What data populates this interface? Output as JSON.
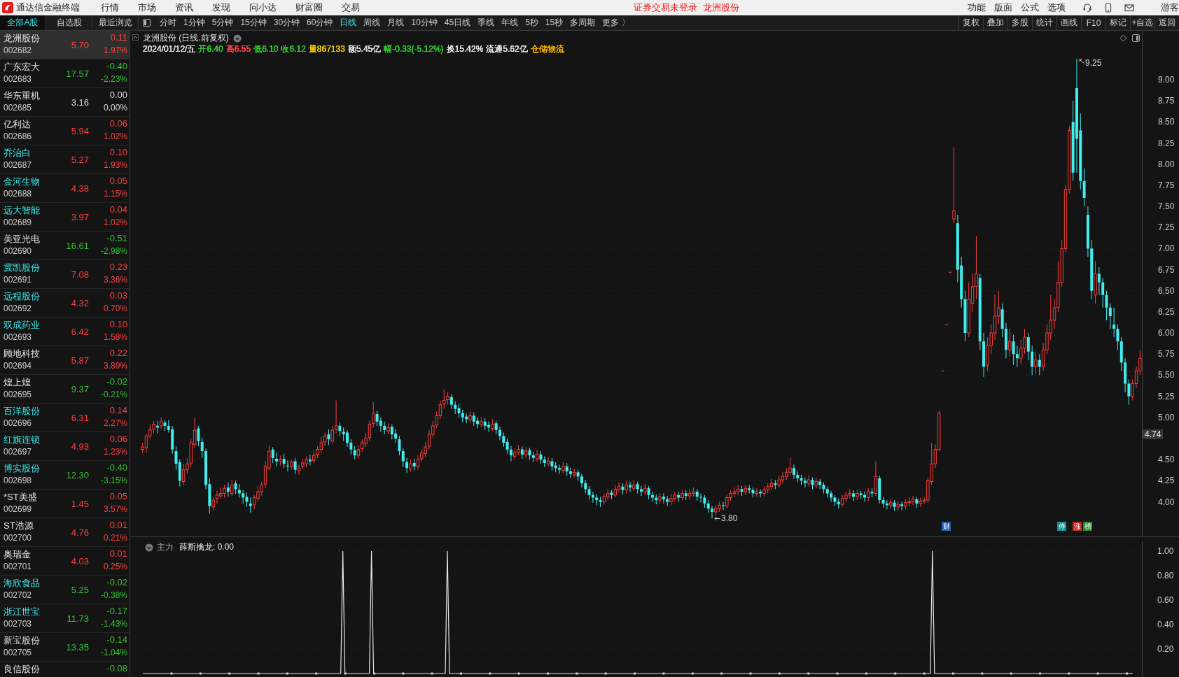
{
  "title_bar": {
    "app_name": "通达信金融终端",
    "menu": [
      "行情",
      "市场",
      "资讯",
      "发现",
      "问小达",
      "财富圈",
      "交易"
    ],
    "login_notice": "证券交易未登录",
    "current_stock": "龙洲股份",
    "tools": [
      "功能",
      "版面",
      "公式",
      "选项"
    ],
    "user": "游客"
  },
  "toolbar": {
    "list_tabs": [
      {
        "label": "全部A股",
        "selected": true
      },
      {
        "label": "自选股",
        "selected": false
      },
      {
        "label": "最近浏览",
        "selected": false
      }
    ],
    "periods": [
      {
        "label": "分时",
        "selected": false
      },
      {
        "label": "1分钟",
        "selected": false
      },
      {
        "label": "5分钟",
        "selected": false
      },
      {
        "label": "15分钟",
        "selected": false
      },
      {
        "label": "30分钟",
        "selected": false
      },
      {
        "label": "60分钟",
        "selected": false
      },
      {
        "label": "日线",
        "selected": true
      },
      {
        "label": "周线",
        "selected": false
      },
      {
        "label": "月线",
        "selected": false
      },
      {
        "label": "10分钟",
        "selected": false
      },
      {
        "label": "45日线",
        "selected": false
      },
      {
        "label": "季线",
        "selected": false
      },
      {
        "label": "年线",
        "selected": false
      },
      {
        "label": "5秒",
        "selected": false
      },
      {
        "label": "15秒",
        "selected": false
      },
      {
        "label": "多周期",
        "selected": false
      }
    ],
    "more_button": "更多 〉",
    "actions": [
      "复权",
      "叠加",
      "多股",
      "统计",
      "画线",
      "F10",
      "标记",
      "+自选",
      "返回"
    ]
  },
  "stock_list": [
    {
      "name": "龙洲股份",
      "code": "002682",
      "price": "5.70",
      "change": "0.11",
      "percent": "1.97%",
      "color": "#ff4040",
      "highlighted": false,
      "selected": true
    },
    {
      "name": "广东宏大",
      "code": "002683",
      "price": "17.57",
      "change": "-0.40",
      "percent": "-2.23%",
      "color": "#34c234",
      "highlighted": false,
      "selected": false
    },
    {
      "name": "华东重机",
      "code": "002685",
      "price": "3.16",
      "change": "0.00",
      "percent": "0.00%",
      "color": "#d8d8d8",
      "highlighted": false,
      "selected": false
    },
    {
      "name": "亿利达",
      "code": "002686",
      "price": "5.94",
      "change": "0.06",
      "percent": "1.02%",
      "color": "#ff4040",
      "highlighted": false,
      "selected": false
    },
    {
      "name": "乔治白",
      "code": "002687",
      "price": "5.27",
      "change": "0.10",
      "percent": "1.93%",
      "color": "#ff4040",
      "highlighted": true,
      "selected": false
    },
    {
      "name": "金河生物",
      "code": "002688",
      "price": "4.38",
      "change": "0.05",
      "percent": "1.15%",
      "color": "#ff4040",
      "highlighted": true,
      "selected": false
    },
    {
      "name": "远大智能",
      "code": "002689",
      "price": "3.97",
      "change": "0.04",
      "percent": "1.02%",
      "color": "#ff4040",
      "highlighted": true,
      "selected": false
    },
    {
      "name": "美亚光电",
      "code": "002690",
      "price": "16.61",
      "change": "-0.51",
      "percent": "-2.98%",
      "color": "#34c234",
      "highlighted": false,
      "selected": false
    },
    {
      "name": "冀凯股份",
      "code": "002691",
      "price": "7.08",
      "change": "0.23",
      "percent": "3.36%",
      "color": "#ff4040",
      "highlighted": true,
      "selected": false
    },
    {
      "name": "远程股份",
      "code": "002692",
      "price": "4.32",
      "change": "0.03",
      "percent": "0.70%",
      "color": "#ff4040",
      "highlighted": true,
      "selected": false
    },
    {
      "name": "双成药业",
      "code": "002693",
      "price": "6.42",
      "change": "0.10",
      "percent": "1.58%",
      "color": "#ff4040",
      "highlighted": true,
      "selected": false
    },
    {
      "name": "顾地科技",
      "code": "002694",
      "price": "5.87",
      "change": "0.22",
      "percent": "3.89%",
      "color": "#ff4040",
      "highlighted": false,
      "selected": false
    },
    {
      "name": "煌上煌",
      "code": "002695",
      "price": "9.37",
      "change": "-0.02",
      "percent": "-0.21%",
      "color": "#34c234",
      "highlighted": false,
      "selected": false
    },
    {
      "name": "百洋股份",
      "code": "002696",
      "price": "6.31",
      "change": "0.14",
      "percent": "2.27%",
      "color": "#ff4040",
      "highlighted": true,
      "selected": false
    },
    {
      "name": "红旗连锁",
      "code": "002697",
      "price": "4.93",
      "change": "0.06",
      "percent": "1.23%",
      "color": "#ff4040",
      "highlighted": true,
      "selected": false
    },
    {
      "name": "博实股份",
      "code": "002698",
      "price": "12.30",
      "change": "-0.40",
      "percent": "-3.15%",
      "color": "#34c234",
      "highlighted": true,
      "selected": false
    },
    {
      "name": "*ST美盛",
      "code": "002699",
      "price": "1.45",
      "change": "0.05",
      "percent": "3.57%",
      "color": "#ff4040",
      "highlighted": false,
      "selected": false
    },
    {
      "name": "ST浩源",
      "code": "002700",
      "price": "4.76",
      "change": "0.01",
      "percent": "0.21%",
      "color": "#ff4040",
      "highlighted": false,
      "selected": false
    },
    {
      "name": "奥瑞金",
      "code": "002701",
      "price": "4.03",
      "change": "0.01",
      "percent": "0.25%",
      "color": "#ff4040",
      "highlighted": false,
      "selected": false
    },
    {
      "name": "海欣食品",
      "code": "002702",
      "price": "5.25",
      "change": "-0.02",
      "percent": "-0.38%",
      "color": "#34c234",
      "highlighted": true,
      "selected": false
    },
    {
      "name": "浙江世宝",
      "code": "002703",
      "price": "11.73",
      "change": "-0.17",
      "percent": "-1.43%",
      "color": "#34c234",
      "highlighted": true,
      "selected": false
    },
    {
      "name": "新宝股份",
      "code": "002705",
      "price": "13.35",
      "change": "-0.14",
      "percent": "-1.04%",
      "color": "#34c234",
      "highlighted": false,
      "selected": false
    },
    {
      "name": "良信股份",
      "change": "-0.08",
      "color": "#34c234",
      "highlighted": false,
      "selected": false
    }
  ],
  "chart": {
    "title": "龙洲股份 (日线.前复权)",
    "info": [
      {
        "text": "2024/01/12/五",
        "color": "#e0e0e0"
      },
      {
        "text": "开6.40",
        "color": "#34c234"
      },
      {
        "text": "高6.55",
        "color": "#ff4040"
      },
      {
        "text": "低6.10",
        "color": "#34c234"
      },
      {
        "text": "收6.12",
        "color": "#34c234"
      },
      {
        "text": "量867133",
        "color": "#e8c200"
      },
      {
        "text": "额5.45亿",
        "color": "#e0e0e0"
      },
      {
        "text": "幅-0.33(-5.12%)",
        "color": "#34c234"
      },
      {
        "text": "换15.42%",
        "color": "#e0e0e0"
      },
      {
        "text": "流通5.62亿",
        "color": "#e0e0e0"
      },
      {
        "text": "仓储物流",
        "color": "#e8a800"
      }
    ],
    "current_price": "4.74",
    "chart_data": {
      "type": "candlestick",
      "grid": true,
      "ylim": [
        3.59,
        9.58
      ],
      "yticks": [
        {
          "value": 9,
          "label": "9.00"
        },
        {
          "value": 8.75,
          "label": "8.75"
        },
        {
          "value": 8.5,
          "label": "8.50"
        },
        {
          "value": 8.25,
          "label": "8.25"
        },
        {
          "value": 8,
          "label": "8.00"
        },
        {
          "value": 7.75,
          "label": "7.75"
        },
        {
          "value": 7.5,
          "label": "7.50"
        },
        {
          "value": 7.25,
          "label": "7.25"
        },
        {
          "value": 7,
          "label": "7.00"
        },
        {
          "value": 6.75,
          "label": "6.75"
        },
        {
          "value": 6.5,
          "label": "6.50"
        },
        {
          "value": 6.25,
          "label": "6.25"
        },
        {
          "value": 6,
          "label": "6.00"
        },
        {
          "value": 5.75,
          "label": "5.75"
        },
        {
          "value": 5.5,
          "label": "5.50"
        },
        {
          "value": 5.25,
          "label": "5.25"
        },
        {
          "value": 5,
          "label": "5.00"
        },
        {
          "value": 4.5,
          "label": "4.50"
        },
        {
          "value": 4.25,
          "label": "4.25"
        },
        {
          "value": 4,
          "label": "4.00"
        }
      ],
      "annotations": [
        "9.25",
        "3.80"
      ],
      "ohlc": [
        [
          4.62,
          4.7,
          4.58,
          4.65
        ],
        [
          4.64,
          4.81,
          4.58,
          4.78
        ],
        [
          4.78,
          4.92,
          4.75,
          4.85
        ],
        [
          4.86,
          4.96,
          4.81,
          4.92
        ],
        [
          4.9,
          4.96,
          4.81,
          4.88
        ],
        [
          4.9,
          5.0,
          4.86,
          4.95
        ],
        [
          4.94,
          4.97,
          4.84,
          4.9
        ],
        [
          4.9,
          4.97,
          4.82,
          4.85
        ],
        [
          4.86,
          4.9,
          4.57,
          4.62
        ],
        [
          4.6,
          4.66,
          4.38,
          4.45
        ],
        [
          4.47,
          4.5,
          4.18,
          4.25
        ],
        [
          4.24,
          4.45,
          4.2,
          4.38
        ],
        [
          4.38,
          4.52,
          4.33,
          4.45
        ],
        [
          4.46,
          4.74,
          4.41,
          4.7
        ],
        [
          4.68,
          4.99,
          4.64,
          4.85
        ],
        [
          4.87,
          4.9,
          4.66,
          4.72
        ],
        [
          4.71,
          4.76,
          4.52,
          4.6
        ],
        [
          4.6,
          4.63,
          4.15,
          4.2
        ],
        [
          4.21,
          4.28,
          3.86,
          3.95
        ],
        [
          3.94,
          4.06,
          3.89,
          4.02
        ],
        [
          4.04,
          4.13,
          3.98,
          4.08
        ],
        [
          4.07,
          4.17,
          4.04,
          4.1
        ],
        [
          4.1,
          4.2,
          4.05,
          4.16
        ],
        [
          4.17,
          4.23,
          4.06,
          4.12
        ],
        [
          4.1,
          4.26,
          4.07,
          4.2
        ],
        [
          4.22,
          4.25,
          4.09,
          4.15
        ],
        [
          4.14,
          4.21,
          4.05,
          4.1
        ],
        [
          4.1,
          4.14,
          3.98,
          4.05
        ],
        [
          4.06,
          4.11,
          3.94,
          4.0
        ],
        [
          3.98,
          4.05,
          3.87,
          3.95
        ],
        [
          3.97,
          4.08,
          3.91,
          4.05
        ],
        [
          4.04,
          4.19,
          4.01,
          4.12
        ],
        [
          4.12,
          4.24,
          4.07,
          4.2
        ],
        [
          4.21,
          4.48,
          4.16,
          4.42
        ],
        [
          4.4,
          4.67,
          4.37,
          4.6
        ],
        [
          4.62,
          4.65,
          4.46,
          4.52
        ],
        [
          4.51,
          4.58,
          4.42,
          4.48
        ],
        [
          4.48,
          4.55,
          4.43,
          4.5
        ],
        [
          4.51,
          4.57,
          4.4,
          4.45
        ],
        [
          4.43,
          4.49,
          4.36,
          4.42
        ],
        [
          4.42,
          4.5,
          4.38,
          4.47
        ],
        [
          4.48,
          4.52,
          4.33,
          4.38
        ],
        [
          4.37,
          4.44,
          4.32,
          4.4
        ],
        [
          4.42,
          4.51,
          4.39,
          4.46
        ],
        [
          4.45,
          4.54,
          4.41,
          4.5
        ],
        [
          4.5,
          4.56,
          4.43,
          4.48
        ],
        [
          4.49,
          4.61,
          4.46,
          4.55
        ],
        [
          4.56,
          4.66,
          4.52,
          4.62
        ],
        [
          4.62,
          4.77,
          4.59,
          4.7
        ],
        [
          4.71,
          4.82,
          4.66,
          4.78
        ],
        [
          4.8,
          4.86,
          4.67,
          4.74
        ],
        [
          4.72,
          4.9,
          4.69,
          4.85
        ],
        [
          4.86,
          5.2,
          4.81,
          4.9
        ],
        [
          4.9,
          4.94,
          4.78,
          4.84
        ],
        [
          4.83,
          4.88,
          4.72,
          4.8
        ],
        [
          4.82,
          4.85,
          4.65,
          4.7
        ],
        [
          4.7,
          4.74,
          4.56,
          4.62
        ],
        [
          4.61,
          4.66,
          4.5,
          4.55
        ],
        [
          4.55,
          4.67,
          4.51,
          4.62
        ],
        [
          4.63,
          4.74,
          4.59,
          4.7
        ],
        [
          4.69,
          4.82,
          4.65,
          4.75
        ],
        [
          4.76,
          4.97,
          4.72,
          4.92
        ],
        [
          4.93,
          5.18,
          4.88,
          5.05
        ],
        [
          5.04,
          5.08,
          4.9,
          4.95
        ],
        [
          4.96,
          5.0,
          4.83,
          4.9
        ],
        [
          4.9,
          4.95,
          4.8,
          4.85
        ],
        [
          4.84,
          4.93,
          4.8,
          4.88
        ],
        [
          4.89,
          4.92,
          4.74,
          4.8
        ],
        [
          4.81,
          4.86,
          4.7,
          4.75
        ],
        [
          4.74,
          4.78,
          4.55,
          4.6
        ],
        [
          4.6,
          4.63,
          4.41,
          4.48
        ],
        [
          4.47,
          4.52,
          4.34,
          4.4
        ],
        [
          4.39,
          4.5,
          4.35,
          4.45
        ],
        [
          4.46,
          4.51,
          4.37,
          4.42
        ],
        [
          4.42,
          4.55,
          4.38,
          4.5
        ],
        [
          4.51,
          4.62,
          4.47,
          4.58
        ],
        [
          4.57,
          4.71,
          4.53,
          4.65
        ],
        [
          4.66,
          4.85,
          4.62,
          4.8
        ],
        [
          4.8,
          4.96,
          4.76,
          4.9
        ],
        [
          4.91,
          5.07,
          4.87,
          5.02
        ],
        [
          5.02,
          5.2,
          4.98,
          5.15
        ],
        [
          5.16,
          5.33,
          5.1,
          5.2
        ],
        [
          5.21,
          5.3,
          5.15,
          5.25
        ],
        [
          5.24,
          5.28,
          5.1,
          5.15
        ],
        [
          5.15,
          5.19,
          5.04,
          5.1
        ],
        [
          5.11,
          5.16,
          5.0,
          5.05
        ],
        [
          5.05,
          5.09,
          4.94,
          5.0
        ],
        [
          5.01,
          5.05,
          4.93,
          4.98
        ],
        [
          4.97,
          5.07,
          4.93,
          5.02
        ],
        [
          5.02,
          5.06,
          4.9,
          4.95
        ],
        [
          4.96,
          5.0,
          4.87,
          4.92
        ],
        [
          4.92,
          5.0,
          4.88,
          4.95
        ],
        [
          4.95,
          4.99,
          4.85,
          4.9
        ],
        [
          4.91,
          4.95,
          4.83,
          4.88
        ],
        [
          4.87,
          4.98,
          4.84,
          4.92
        ],
        [
          4.93,
          4.96,
          4.8,
          4.85
        ],
        [
          4.85,
          4.89,
          4.73,
          4.78
        ],
        [
          4.78,
          4.82,
          4.65,
          4.7
        ],
        [
          4.71,
          4.75,
          4.57,
          4.62
        ],
        [
          4.62,
          4.66,
          4.48,
          4.55
        ],
        [
          4.54,
          4.63,
          4.5,
          4.58
        ],
        [
          4.59,
          4.67,
          4.55,
          4.62
        ],
        [
          4.62,
          4.66,
          4.51,
          4.56
        ],
        [
          4.56,
          4.65,
          4.52,
          4.6
        ],
        [
          4.61,
          4.64,
          4.5,
          4.55
        ],
        [
          4.55,
          4.59,
          4.47,
          4.52
        ],
        [
          4.51,
          4.61,
          4.48,
          4.56
        ],
        [
          4.56,
          4.6,
          4.45,
          4.5
        ],
        [
          4.5,
          4.54,
          4.41,
          4.46
        ],
        [
          4.45,
          4.53,
          4.42,
          4.48
        ],
        [
          4.48,
          4.52,
          4.37,
          4.42
        ],
        [
          4.43,
          4.47,
          4.35,
          4.4
        ],
        [
          4.4,
          4.44,
          4.33,
          4.38
        ],
        [
          4.37,
          4.47,
          4.34,
          4.42
        ],
        [
          4.42,
          4.46,
          4.31,
          4.36
        ],
        [
          4.36,
          4.4,
          4.28,
          4.33
        ],
        [
          4.32,
          4.39,
          4.29,
          4.35
        ],
        [
          4.35,
          4.38,
          4.25,
          4.3
        ],
        [
          4.3,
          4.33,
          4.17,
          4.22
        ],
        [
          4.22,
          4.26,
          4.1,
          4.15
        ],
        [
          4.15,
          4.19,
          4.03,
          4.08
        ],
        [
          4.08,
          4.12,
          3.99,
          4.05
        ],
        [
          4.05,
          4.09,
          3.96,
          4.02
        ],
        [
          4.02,
          4.06,
          3.94,
          4.0
        ],
        [
          4.0,
          4.1,
          3.97,
          4.06
        ],
        [
          4.06,
          4.15,
          4.02,
          4.1
        ],
        [
          4.11,
          4.14,
          4.03,
          4.08
        ],
        [
          4.08,
          4.2,
          4.05,
          4.15
        ],
        [
          4.15,
          4.23,
          4.11,
          4.18
        ],
        [
          4.18,
          4.22,
          4.09,
          4.14
        ],
        [
          4.14,
          4.25,
          4.1,
          4.2
        ],
        [
          4.2,
          4.24,
          4.12,
          4.17
        ],
        [
          4.16,
          4.26,
          4.13,
          4.2
        ],
        [
          4.21,
          4.24,
          4.1,
          4.15
        ],
        [
          4.15,
          4.19,
          4.07,
          4.12
        ],
        [
          4.12,
          4.21,
          4.08,
          4.16
        ],
        [
          4.16,
          4.19,
          4.03,
          4.08
        ],
        [
          4.08,
          4.12,
          4.0,
          4.05
        ],
        [
          4.05,
          4.09,
          3.97,
          4.02
        ],
        [
          4.02,
          4.1,
          3.98,
          4.06
        ],
        [
          4.06,
          4.1,
          3.98,
          4.03
        ],
        [
          4.03,
          4.07,
          3.95,
          4.0
        ],
        [
          4.0,
          4.09,
          3.96,
          4.04
        ],
        [
          4.04,
          4.12,
          4.01,
          4.08
        ],
        [
          4.08,
          4.12,
          4.0,
          4.05
        ],
        [
          4.05,
          4.14,
          4.02,
          4.1
        ],
        [
          4.1,
          4.14,
          4.02,
          4.07
        ],
        [
          4.07,
          4.15,
          4.03,
          4.1
        ],
        [
          4.1,
          4.17,
          4.06,
          4.12
        ],
        [
          4.12,
          4.15,
          4.01,
          4.06
        ],
        [
          4.06,
          4.1,
          3.99,
          4.05
        ],
        [
          4.05,
          4.08,
          3.93,
          3.98
        ],
        [
          3.98,
          4.02,
          3.87,
          3.92
        ],
        [
          3.92,
          3.95,
          3.8,
          3.88
        ],
        [
          3.88,
          3.96,
          3.84,
          3.92
        ],
        [
          3.92,
          4.0,
          3.88,
          3.96
        ],
        [
          3.96,
          4.0,
          3.9,
          3.95
        ],
        [
          3.95,
          4.09,
          3.92,
          4.05
        ],
        [
          4.05,
          4.14,
          4.01,
          4.1
        ],
        [
          4.1,
          4.17,
          4.06,
          4.12
        ],
        [
          4.12,
          4.2,
          4.08,
          4.15
        ],
        [
          4.15,
          4.19,
          4.07,
          4.12
        ],
        [
          4.12,
          4.2,
          4.08,
          4.16
        ],
        [
          4.16,
          4.2,
          4.1,
          4.14
        ],
        [
          4.14,
          4.17,
          4.05,
          4.1
        ],
        [
          4.1,
          4.16,
          4.06,
          4.12
        ],
        [
          4.12,
          4.15,
          4.05,
          4.1
        ],
        [
          4.1,
          4.18,
          4.06,
          4.14
        ],
        [
          4.14,
          4.22,
          4.1,
          4.18
        ],
        [
          4.18,
          4.27,
          4.14,
          4.22
        ],
        [
          4.22,
          4.26,
          4.15,
          4.2
        ],
        [
          4.2,
          4.31,
          4.16,
          4.26
        ],
        [
          4.26,
          4.35,
          4.22,
          4.3
        ],
        [
          4.3,
          4.4,
          4.26,
          4.35
        ],
        [
          4.35,
          4.52,
          4.31,
          4.4
        ],
        [
          4.4,
          4.44,
          4.27,
          4.32
        ],
        [
          4.32,
          4.36,
          4.23,
          4.28
        ],
        [
          4.28,
          4.32,
          4.2,
          4.25
        ],
        [
          4.25,
          4.29,
          4.17,
          4.22
        ],
        [
          4.22,
          4.31,
          4.18,
          4.26
        ],
        [
          4.26,
          4.29,
          4.15,
          4.2
        ],
        [
          4.2,
          4.29,
          4.16,
          4.24
        ],
        [
          4.24,
          4.27,
          4.15,
          4.2
        ],
        [
          4.2,
          4.23,
          4.1,
          4.15
        ],
        [
          4.15,
          4.18,
          4.05,
          4.1
        ],
        [
          4.1,
          4.13,
          4.0,
          4.05
        ],
        [
          4.05,
          4.08,
          3.95,
          4.0
        ],
        [
          4.0,
          4.04,
          3.92,
          3.97
        ],
        [
          3.97,
          4.08,
          3.94,
          4.04
        ],
        [
          4.04,
          4.12,
          4.0,
          4.08
        ],
        [
          4.08,
          4.15,
          4.04,
          4.1
        ],
        [
          4.1,
          4.14,
          4.01,
          4.06
        ],
        [
          4.06,
          4.14,
          4.02,
          4.1
        ],
        [
          4.1,
          4.13,
          4.03,
          4.08
        ],
        [
          4.08,
          4.12,
          4.0,
          4.05
        ],
        [
          4.05,
          4.16,
          4.01,
          4.12
        ],
        [
          4.12,
          4.16,
          4.05,
          4.1
        ],
        [
          4.1,
          4.48,
          4.07,
          4.3
        ],
        [
          4.28,
          4.31,
          3.98,
          4.02
        ],
        [
          4.02,
          4.06,
          3.93,
          3.98
        ],
        [
          3.98,
          4.02,
          3.91,
          3.96
        ],
        [
          3.96,
          4.03,
          3.92,
          3.99
        ],
        [
          3.99,
          4.02,
          3.89,
          3.94
        ],
        [
          3.94,
          4.01,
          3.9,
          3.97
        ],
        [
          3.97,
          4.0,
          3.9,
          3.95
        ],
        [
          3.95,
          4.03,
          3.91,
          3.99
        ],
        [
          3.99,
          4.05,
          3.95,
          4.0
        ],
        [
          4.0,
          4.07,
          3.96,
          4.03
        ],
        [
          4.03,
          4.06,
          3.93,
          3.98
        ],
        [
          3.98,
          4.05,
          3.94,
          4.01
        ],
        [
          4.01,
          4.06,
          3.97,
          4.02
        ],
        [
          4.02,
          4.29,
          3.99,
          4.25
        ],
        [
          4.24,
          4.7,
          4.2,
          4.45
        ],
        [
          4.45,
          4.68,
          4.4,
          4.62
        ],
        [
          4.62,
          5.08,
          4.6,
          5.05
        ],
        [
          5.55,
          5.55,
          5.55,
          5.55
        ],
        [
          6.1,
          6.1,
          6.1,
          6.1
        ],
        [
          6.72,
          6.72,
          6.72,
          6.72
        ],
        [
          7.35,
          8.2,
          7.3,
          7.45
        ],
        [
          7.3,
          7.4,
          6.6,
          6.75
        ],
        [
          6.8,
          6.9,
          6.3,
          6.4
        ],
        [
          6.4,
          6.5,
          5.9,
          6.0
        ],
        [
          6.0,
          6.6,
          5.95,
          6.4
        ],
        [
          6.35,
          6.7,
          6.25,
          6.55
        ],
        [
          6.55,
          7.15,
          6.4,
          6.7
        ],
        [
          6.65,
          6.7,
          5.8,
          5.9
        ],
        [
          5.9,
          6.0,
          5.48,
          5.6
        ],
        [
          5.62,
          5.95,
          5.55,
          5.85
        ],
        [
          5.85,
          6.1,
          5.75,
          6.0
        ],
        [
          6.0,
          6.45,
          5.92,
          6.2
        ],
        [
          6.2,
          6.5,
          6.1,
          6.3
        ],
        [
          6.28,
          6.35,
          5.95,
          6.05
        ],
        [
          6.05,
          6.12,
          5.7,
          5.8
        ],
        [
          5.8,
          6.05,
          5.72,
          5.9
        ],
        [
          5.9,
          5.98,
          5.62,
          5.75
        ],
        [
          5.75,
          5.85,
          5.6,
          5.7
        ],
        [
          5.7,
          5.92,
          5.63,
          5.82
        ],
        [
          5.82,
          6.05,
          5.75,
          5.95
        ],
        [
          5.95,
          6.0,
          5.68,
          5.78
        ],
        [
          5.78,
          5.85,
          5.5,
          5.6
        ],
        [
          5.6,
          5.78,
          5.52,
          5.68
        ],
        [
          5.68,
          5.75,
          5.5,
          5.6
        ],
        [
          5.6,
          5.88,
          5.55,
          5.8
        ],
        [
          5.8,
          6.1,
          5.75,
          6.0
        ],
        [
          6.0,
          6.45,
          5.92,
          6.15
        ],
        [
          6.15,
          6.4,
          6.05,
          6.3
        ],
        [
          6.3,
          6.85,
          6.25,
          6.6
        ],
        [
          6.6,
          7.1,
          6.55,
          7.0
        ],
        [
          7.0,
          7.75,
          6.95,
          7.7
        ],
        [
          7.7,
          8.45,
          7.65,
          8.4
        ],
        [
          8.5,
          8.75,
          7.8,
          7.9
        ],
        [
          8.9,
          9.25,
          7.9,
          8.3
        ],
        [
          8.4,
          8.6,
          7.7,
          7.8
        ],
        [
          7.8,
          7.95,
          7.5,
          7.6
        ],
        [
          7.4,
          7.5,
          6.9,
          7.0
        ],
        [
          7.0,
          7.1,
          6.4,
          6.5
        ],
        [
          6.45,
          6.85,
          6.35,
          6.7
        ],
        [
          6.7,
          6.78,
          6.45,
          6.6
        ],
        [
          6.6,
          6.65,
          6.3,
          6.45
        ],
        [
          6.45,
          6.5,
          6.15,
          6.3
        ],
        [
          6.3,
          6.35,
          6.05,
          6.2
        ],
        [
          6.1,
          6.3,
          5.95,
          6.05
        ],
        [
          6.05,
          6.1,
          5.8,
          5.9
        ],
        [
          5.9,
          5.95,
          5.55,
          5.65
        ],
        [
          5.65,
          5.7,
          5.3,
          5.4
        ],
        [
          5.4,
          5.45,
          5.15,
          5.25
        ],
        [
          5.25,
          5.45,
          5.2,
          5.4
        ],
        [
          5.4,
          5.6,
          5.35,
          5.55
        ],
        [
          5.55,
          5.8,
          5.5,
          5.7
        ]
      ]
    },
    "event_badges": [
      {
        "text": "财",
        "color": "#1f5fb0"
      },
      {
        "text": "停",
        "color": "#11908f"
      },
      {
        "text": "涨",
        "color": "#c42222"
      },
      {
        "text": "榜",
        "color": "#2a8a2a"
      }
    ]
  },
  "indicator": {
    "name": "主力",
    "reading": "薛斯擒龙: 0.00",
    "axis": [
      "1.00",
      "0.80",
      "0.60",
      "0.40",
      "0.20"
    ]
  }
}
